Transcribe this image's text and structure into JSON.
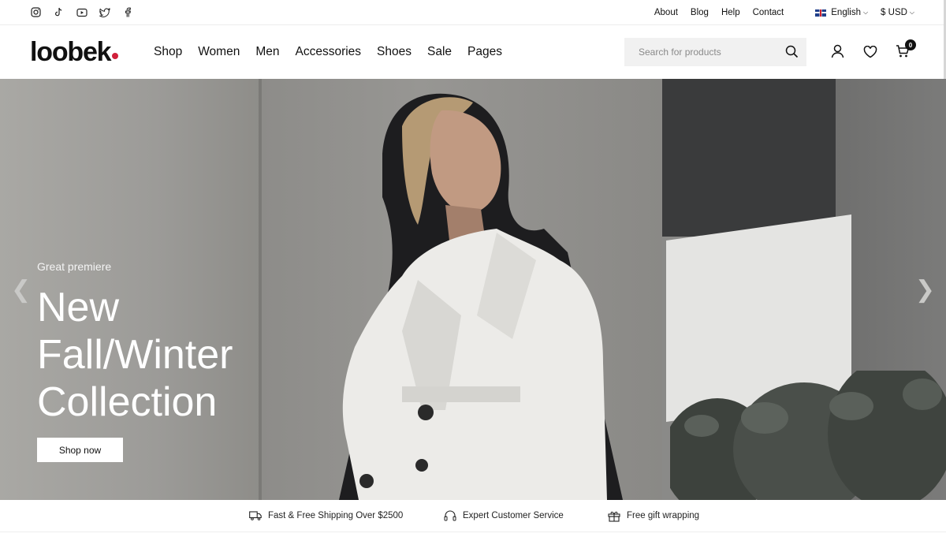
{
  "topbar": {
    "social_icons": [
      "instagram-icon",
      "tiktok-icon",
      "youtube-icon",
      "twitter-icon",
      "facebook-icon"
    ],
    "links": [
      "About",
      "Blog",
      "Help",
      "Contact"
    ],
    "language": "English",
    "currency": "$ USD"
  },
  "header": {
    "logo": "loobek",
    "nav": [
      "Shop",
      "Women",
      "Men",
      "Accessories",
      "Shoes",
      "Sale",
      "Pages"
    ],
    "search_placeholder": "Search for products",
    "cart_count": "0",
    "accent_color": "#d1203a"
  },
  "hero": {
    "subtitle": "Great premiere",
    "title_lines": [
      "New",
      "Fall/Winter",
      "Collection"
    ],
    "button": "Shop now",
    "prev_arrow": "❮",
    "next_arrow": "❯"
  },
  "features": [
    {
      "icon": "truck-icon",
      "label": "Fast & Free Shipping Over $2500"
    },
    {
      "icon": "headset-icon",
      "label": "Expert Customer Service"
    },
    {
      "icon": "gift-icon",
      "label": "Free gift wrapping"
    }
  ]
}
